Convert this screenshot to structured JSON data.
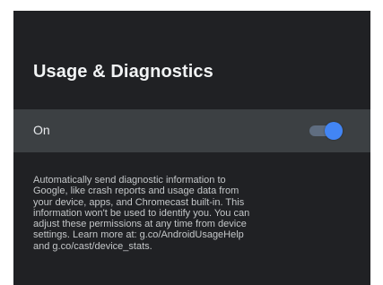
{
  "page": {
    "title": "Usage & Diagnostics"
  },
  "setting": {
    "label": "On",
    "enabled": true,
    "accent_color": "#4285f4"
  },
  "description": {
    "lines": [
      "Automatically send diagnostic information to",
      "Google, like crash reports and usage data from",
      "your device, apps, and Chromecast built-in. This",
      "information won't be used to identify you. You can",
      "adjust these permissions at any time from device",
      "settings. Learn more at: g.co/AndroidUsageHelp",
      "and g.co/cast/device_stats."
    ]
  }
}
